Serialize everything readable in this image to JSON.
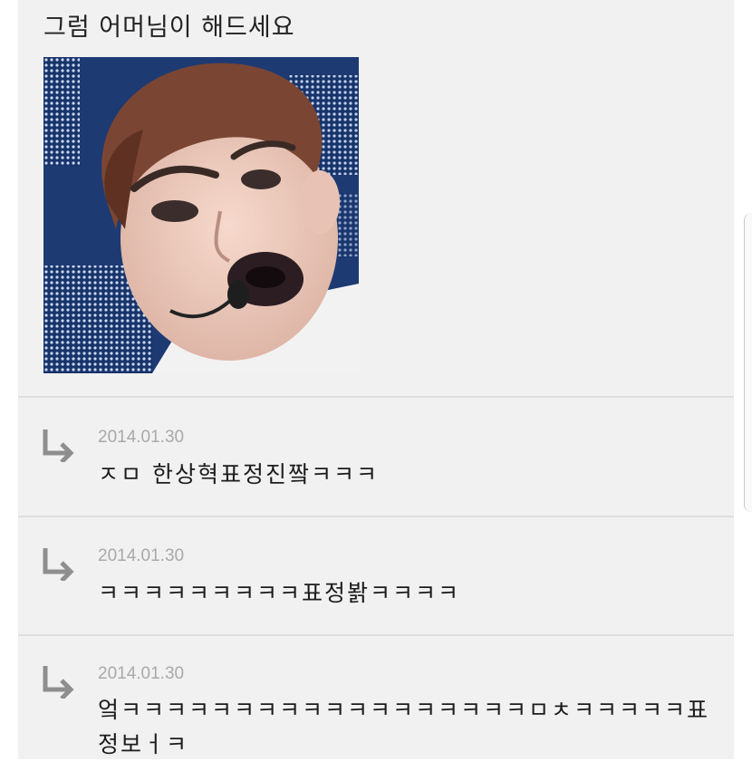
{
  "post": {
    "text": "그럼 어머님이 해드세요"
  },
  "replies": [
    {
      "icon": "reply-arrow-icon",
      "date": "2014.01.30",
      "text": "ㅈㅁ 한상혁표정진짴ㅋㅋㅋ"
    },
    {
      "icon": "reply-arrow-icon",
      "date": "2014.01.30",
      "text": "ㅋㅋㅋㅋㅋㅋㅋㅋㅋ표정봙ㅋㅋㅋㅋ"
    },
    {
      "icon": "reply-arrow-icon",
      "date": "2014.01.30",
      "text": "엌ㅋㅋㅋㅋㅋㅋㅋㅋㅋㅋㅋㅋㅋㅋㅋㅋㅋㅋㅁㅊㅋㅋㅋㅋㅋ표정보ㅓㅋ"
    }
  ],
  "colors": {
    "panel": "#f1f1f1",
    "date": "#a9a9a9",
    "arrow": "#8e8e8e"
  }
}
